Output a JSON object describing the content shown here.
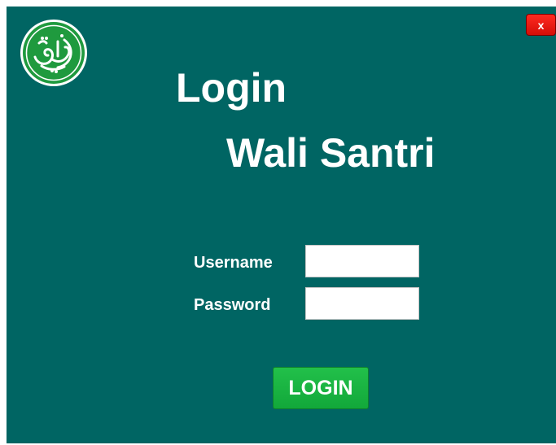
{
  "window": {
    "background_color": "#006563"
  },
  "header": {
    "close_label": "x",
    "logo_icon": "quran-calligraphy-logo-icon",
    "logo_text": "قرآني"
  },
  "title": {
    "line1": "Login",
    "line2": "Wali Santri"
  },
  "form": {
    "username_label": "Username",
    "username_value": "",
    "password_label": "Password",
    "password_value": "",
    "login_button_label": "LOGIN"
  },
  "colors": {
    "close_button": "#e8130c",
    "login_button": "#19b443",
    "logo_green": "#1f9a3e"
  }
}
